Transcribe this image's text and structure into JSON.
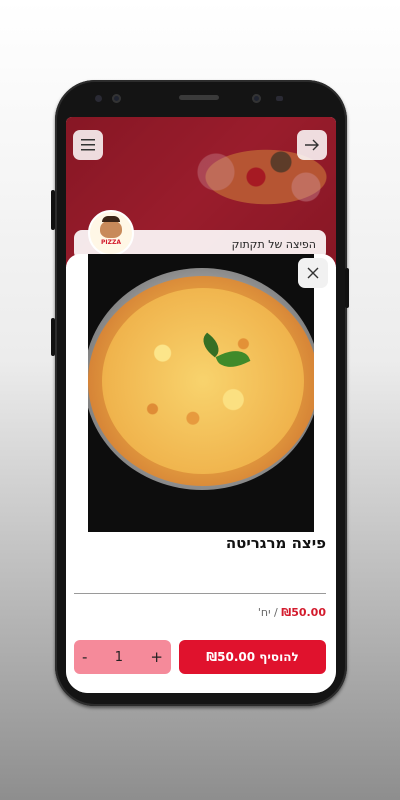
{
  "restaurant": {
    "name": "הפיצה של תקתוק",
    "logo_text": "PIZZA"
  },
  "product": {
    "title": "פיצה מרגריטה",
    "price": "₪50.00",
    "unit_label": "/ יח'"
  },
  "cart": {
    "quantity": "1",
    "minus_label": "-",
    "plus_label": "+",
    "add_button_label": "להוסיף ₪50.00"
  },
  "icons": {
    "menu": "hamburger-icon",
    "back": "arrow-right-icon",
    "close": "close-icon"
  },
  "colors": {
    "brand_red": "#e0122d",
    "price_red": "#d31b2d",
    "qty_pink": "#f58a9a"
  }
}
